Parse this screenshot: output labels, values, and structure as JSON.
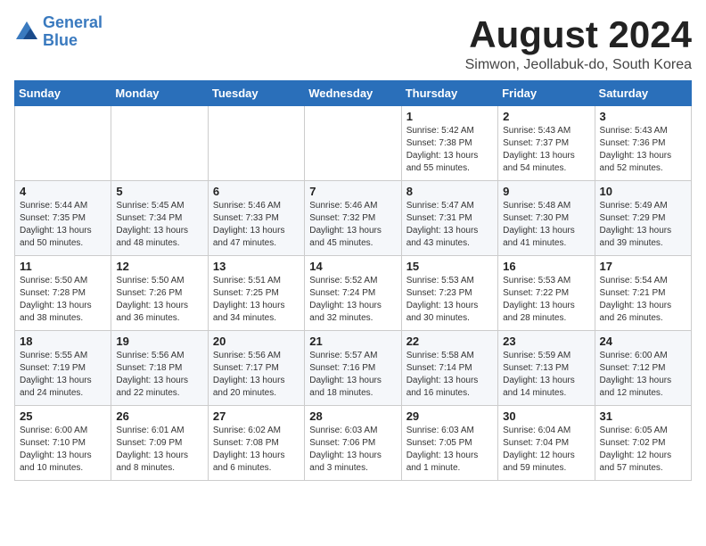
{
  "header": {
    "logo_line1": "General",
    "logo_line2": "Blue",
    "month_title": "August 2024",
    "location": "Simwon, Jeollabuk-do, South Korea"
  },
  "days_of_week": [
    "Sunday",
    "Monday",
    "Tuesday",
    "Wednesday",
    "Thursday",
    "Friday",
    "Saturday"
  ],
  "weeks": [
    [
      {
        "day": "",
        "info": ""
      },
      {
        "day": "",
        "info": ""
      },
      {
        "day": "",
        "info": ""
      },
      {
        "day": "",
        "info": ""
      },
      {
        "day": "1",
        "info": "Sunrise: 5:42 AM\nSunset: 7:38 PM\nDaylight: 13 hours\nand 55 minutes."
      },
      {
        "day": "2",
        "info": "Sunrise: 5:43 AM\nSunset: 7:37 PM\nDaylight: 13 hours\nand 54 minutes."
      },
      {
        "day": "3",
        "info": "Sunrise: 5:43 AM\nSunset: 7:36 PM\nDaylight: 13 hours\nand 52 minutes."
      }
    ],
    [
      {
        "day": "4",
        "info": "Sunrise: 5:44 AM\nSunset: 7:35 PM\nDaylight: 13 hours\nand 50 minutes."
      },
      {
        "day": "5",
        "info": "Sunrise: 5:45 AM\nSunset: 7:34 PM\nDaylight: 13 hours\nand 48 minutes."
      },
      {
        "day": "6",
        "info": "Sunrise: 5:46 AM\nSunset: 7:33 PM\nDaylight: 13 hours\nand 47 minutes."
      },
      {
        "day": "7",
        "info": "Sunrise: 5:46 AM\nSunset: 7:32 PM\nDaylight: 13 hours\nand 45 minutes."
      },
      {
        "day": "8",
        "info": "Sunrise: 5:47 AM\nSunset: 7:31 PM\nDaylight: 13 hours\nand 43 minutes."
      },
      {
        "day": "9",
        "info": "Sunrise: 5:48 AM\nSunset: 7:30 PM\nDaylight: 13 hours\nand 41 minutes."
      },
      {
        "day": "10",
        "info": "Sunrise: 5:49 AM\nSunset: 7:29 PM\nDaylight: 13 hours\nand 39 minutes."
      }
    ],
    [
      {
        "day": "11",
        "info": "Sunrise: 5:50 AM\nSunset: 7:28 PM\nDaylight: 13 hours\nand 38 minutes."
      },
      {
        "day": "12",
        "info": "Sunrise: 5:50 AM\nSunset: 7:26 PM\nDaylight: 13 hours\nand 36 minutes."
      },
      {
        "day": "13",
        "info": "Sunrise: 5:51 AM\nSunset: 7:25 PM\nDaylight: 13 hours\nand 34 minutes."
      },
      {
        "day": "14",
        "info": "Sunrise: 5:52 AM\nSunset: 7:24 PM\nDaylight: 13 hours\nand 32 minutes."
      },
      {
        "day": "15",
        "info": "Sunrise: 5:53 AM\nSunset: 7:23 PM\nDaylight: 13 hours\nand 30 minutes."
      },
      {
        "day": "16",
        "info": "Sunrise: 5:53 AM\nSunset: 7:22 PM\nDaylight: 13 hours\nand 28 minutes."
      },
      {
        "day": "17",
        "info": "Sunrise: 5:54 AM\nSunset: 7:21 PM\nDaylight: 13 hours\nand 26 minutes."
      }
    ],
    [
      {
        "day": "18",
        "info": "Sunrise: 5:55 AM\nSunset: 7:19 PM\nDaylight: 13 hours\nand 24 minutes."
      },
      {
        "day": "19",
        "info": "Sunrise: 5:56 AM\nSunset: 7:18 PM\nDaylight: 13 hours\nand 22 minutes."
      },
      {
        "day": "20",
        "info": "Sunrise: 5:56 AM\nSunset: 7:17 PM\nDaylight: 13 hours\nand 20 minutes."
      },
      {
        "day": "21",
        "info": "Sunrise: 5:57 AM\nSunset: 7:16 PM\nDaylight: 13 hours\nand 18 minutes."
      },
      {
        "day": "22",
        "info": "Sunrise: 5:58 AM\nSunset: 7:14 PM\nDaylight: 13 hours\nand 16 minutes."
      },
      {
        "day": "23",
        "info": "Sunrise: 5:59 AM\nSunset: 7:13 PM\nDaylight: 13 hours\nand 14 minutes."
      },
      {
        "day": "24",
        "info": "Sunrise: 6:00 AM\nSunset: 7:12 PM\nDaylight: 13 hours\nand 12 minutes."
      }
    ],
    [
      {
        "day": "25",
        "info": "Sunrise: 6:00 AM\nSunset: 7:10 PM\nDaylight: 13 hours\nand 10 minutes."
      },
      {
        "day": "26",
        "info": "Sunrise: 6:01 AM\nSunset: 7:09 PM\nDaylight: 13 hours\nand 8 minutes."
      },
      {
        "day": "27",
        "info": "Sunrise: 6:02 AM\nSunset: 7:08 PM\nDaylight: 13 hours\nand 6 minutes."
      },
      {
        "day": "28",
        "info": "Sunrise: 6:03 AM\nSunset: 7:06 PM\nDaylight: 13 hours\nand 3 minutes."
      },
      {
        "day": "29",
        "info": "Sunrise: 6:03 AM\nSunset: 7:05 PM\nDaylight: 13 hours\nand 1 minute."
      },
      {
        "day": "30",
        "info": "Sunrise: 6:04 AM\nSunset: 7:04 PM\nDaylight: 12 hours\nand 59 minutes."
      },
      {
        "day": "31",
        "info": "Sunrise: 6:05 AM\nSunset: 7:02 PM\nDaylight: 12 hours\nand 57 minutes."
      }
    ]
  ]
}
